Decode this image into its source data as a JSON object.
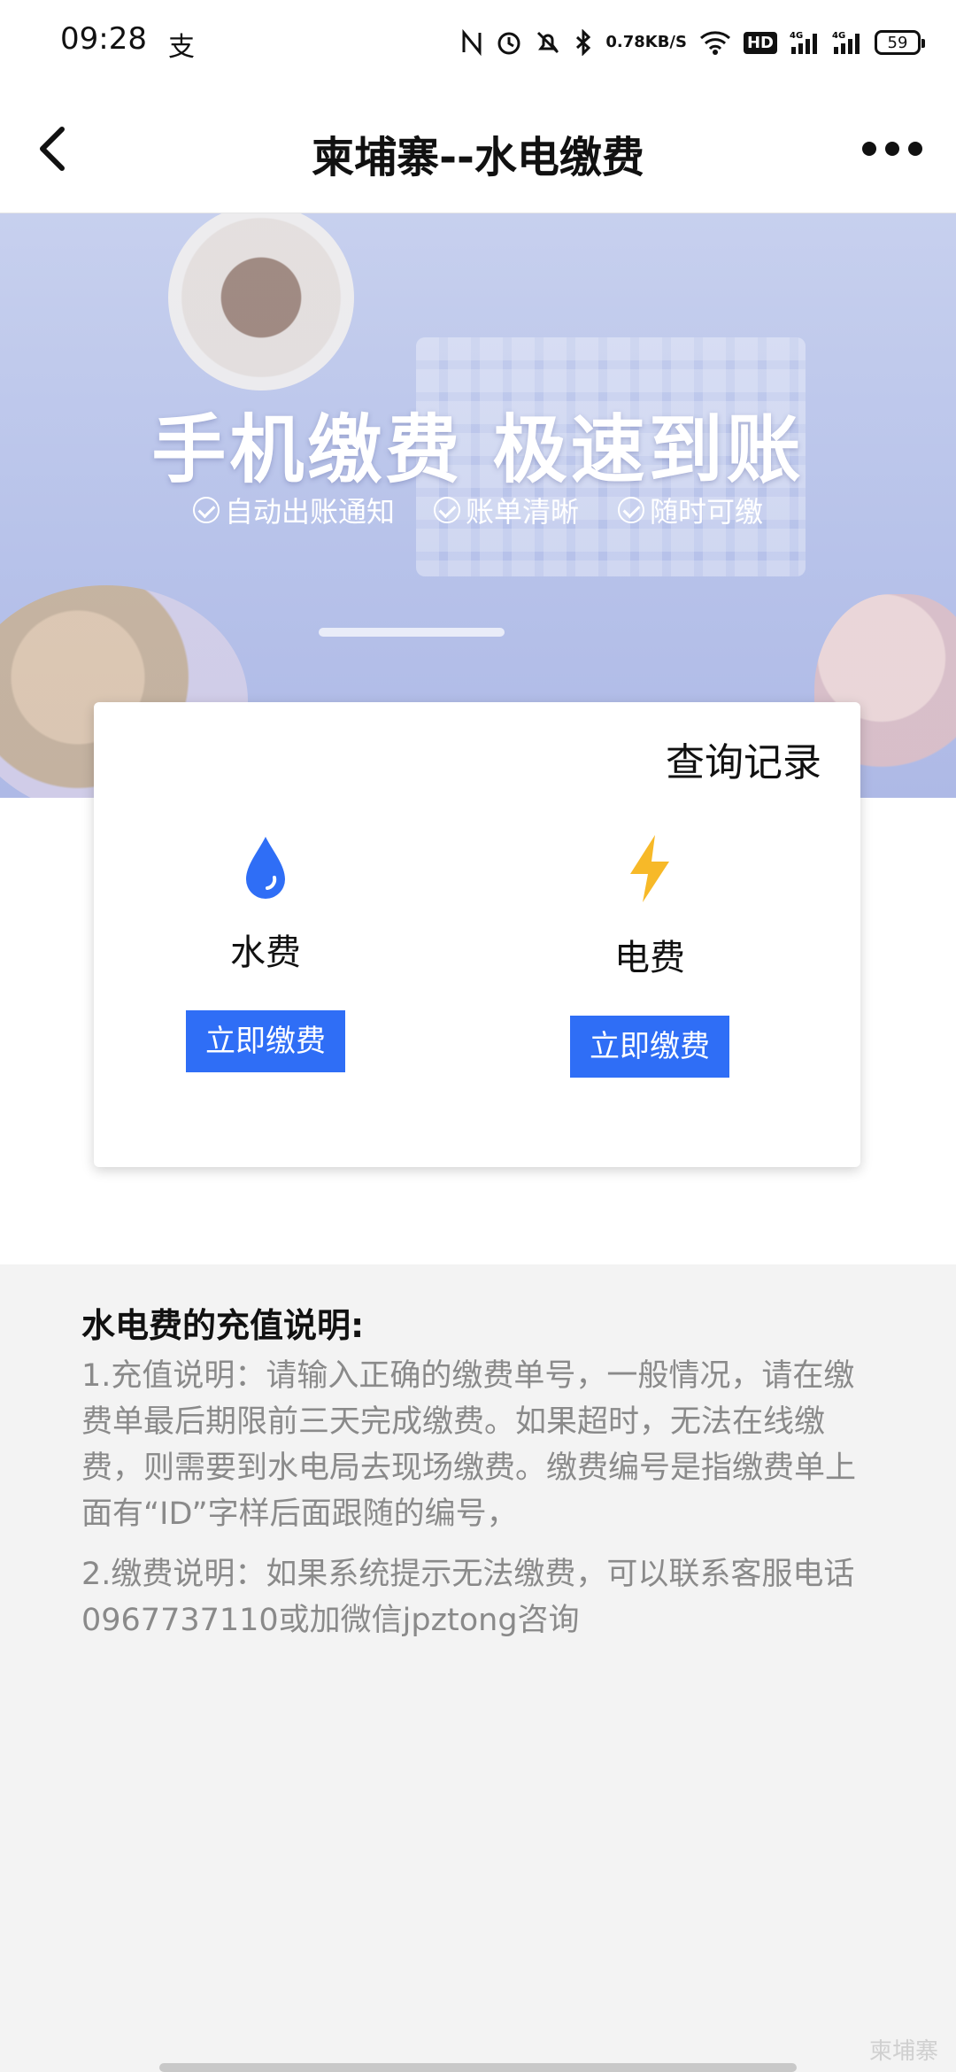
{
  "status_bar": {
    "time": "09:28",
    "app_icon": "支",
    "net_speed_value": "0.78",
    "net_speed_unit": "KB/S",
    "hd_badge": "HD",
    "signal_1": "4G",
    "signal_2": "4G",
    "battery": "59"
  },
  "nav": {
    "title": "柬埔寨--水电缴费"
  },
  "banner": {
    "headline": "手机缴费 极速到账",
    "features": [
      "自动出账通知",
      "账单清晰",
      "随时可缴"
    ]
  },
  "card": {
    "records_link": "查询记录",
    "water": {
      "label": "水费",
      "button": "立即缴费",
      "icon": "water-drop-icon",
      "color": "#2f6ef6"
    },
    "electric": {
      "label": "电费",
      "button": "立即缴费",
      "icon": "lightning-icon",
      "color": "#f7b928"
    }
  },
  "description": {
    "title": "水电费的充值说明:",
    "item1": "1.充值说明：请输入正确的缴费单号，一般情况，请在缴费单最后期限前三天完成缴费。如果超时，无法在线缴费，则需要到水电局去现场缴费。缴费编号是指缴费单上面有“ID”字样后面跟随的编号，",
    "item2": "2.缴费说明：如果系统提示无法缴费，可以联系客服电话0967737110或加微信jpztong咨询"
  },
  "watermark": "柬埔寨"
}
